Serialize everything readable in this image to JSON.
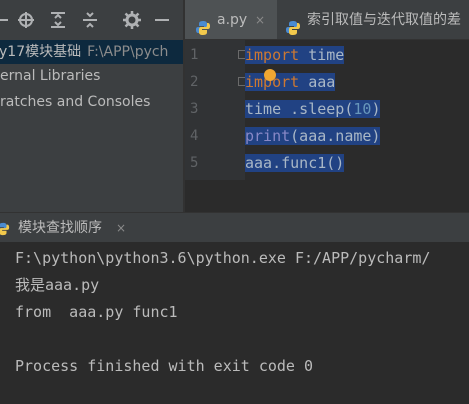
{
  "project_panel": {
    "tree": [
      {
        "label": "y17模块基础",
        "path": "F:\\APP\\pych"
      },
      {
        "label": "ernal Libraries"
      },
      {
        "label": "ratches and Consoles"
      }
    ]
  },
  "editor": {
    "tabs": [
      {
        "label": "a.py",
        "close": "×"
      },
      {
        "label": "索引取值与迭代取值的差"
      }
    ],
    "line_numbers": [
      "1",
      "2",
      "3",
      "4",
      "5"
    ],
    "code": [
      {
        "kw": "import",
        "rest": " time"
      },
      {
        "kw": "import",
        "rest": " aaa"
      },
      {
        "pre": "time .sleep(",
        "num": "10",
        "post": ")"
      },
      {
        "fn": "print",
        "rest": "(aaa.name)"
      },
      {
        "plain": "aaa.func1()"
      }
    ]
  },
  "run": {
    "title": "模块查找顺序",
    "close": "×",
    "output": [
      "F:\\python\\python3.6\\python.exe F:/APP/pycharm/",
      "我是aaa.py",
      "from  aaa.py func1",
      "",
      "Process finished with exit code 0"
    ]
  },
  "colors": {
    "selection": "#214283",
    "keyword": "#cc7832",
    "number": "#6897bb",
    "builtin": "#8888c6"
  }
}
